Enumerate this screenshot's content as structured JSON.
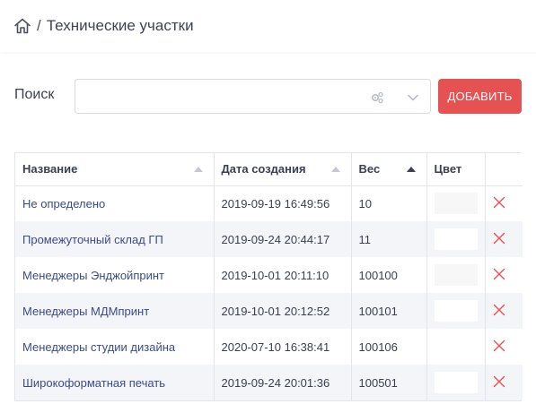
{
  "header": {
    "separator": "/",
    "title": "Технические участки"
  },
  "search": {
    "label": "Поиск",
    "value": "",
    "placeholder": ""
  },
  "actions": {
    "add_label": "ДОБАВИТЬ"
  },
  "colors": {
    "accent": "#e65252",
    "link": "#3b4b8a",
    "delete": "#e65252"
  },
  "table": {
    "columns": [
      {
        "label": "Название",
        "sort": "asc",
        "active": false
      },
      {
        "label": "Дата создания",
        "sort": "asc",
        "active": false
      },
      {
        "label": "Вес",
        "sort": "asc",
        "active": true
      },
      {
        "label": "Цвет"
      },
      {
        "label": ""
      }
    ],
    "rows": [
      {
        "name": "Не определено",
        "created": "2019-09-19 16:49:56",
        "weight": "10",
        "color": "#f7f7f8"
      },
      {
        "name": "Промежуточный склад ГП",
        "created": "2019-09-24 20:44:17",
        "weight": "11",
        "color": "#ffffff"
      },
      {
        "name": "Менеджеры Энджойпринт",
        "created": "2019-10-01 20:11:10",
        "weight": "100100",
        "color": "#f7f7f8"
      },
      {
        "name": "Менеджеры МДМпринт",
        "created": "2019-10-01 20:12:52",
        "weight": "100101",
        "color": "#ffffff"
      },
      {
        "name": "Менеджеры студии дизайна",
        "created": "2020-07-10 16:38:41",
        "weight": "100106",
        "color": ""
      },
      {
        "name": "Широкоформатная печать",
        "created": "2019-09-24 20:01:36",
        "weight": "100501",
        "color": "#ffffff"
      }
    ]
  }
}
